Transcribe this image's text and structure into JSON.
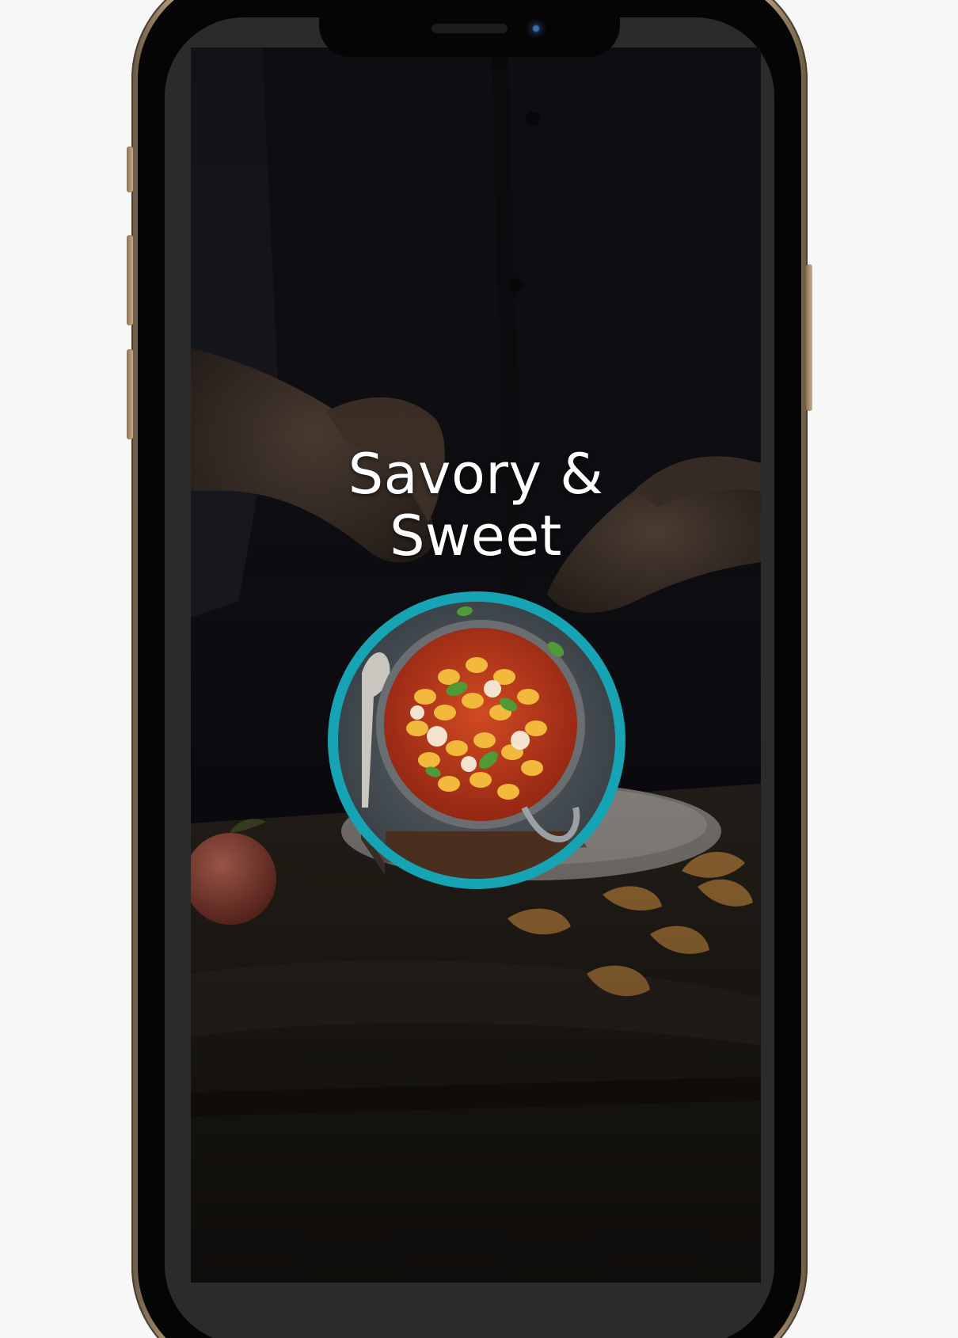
{
  "app": {
    "headline_line1": "Savory &",
    "headline_line2": "Sweet"
  },
  "device": {
    "frame_color": "#c8ab86",
    "accent_ring_color": "#16a3b3"
  },
  "icons": {
    "dish": "baked-gnocchi-pan-photo",
    "background": "chef-plating-food-photo"
  }
}
